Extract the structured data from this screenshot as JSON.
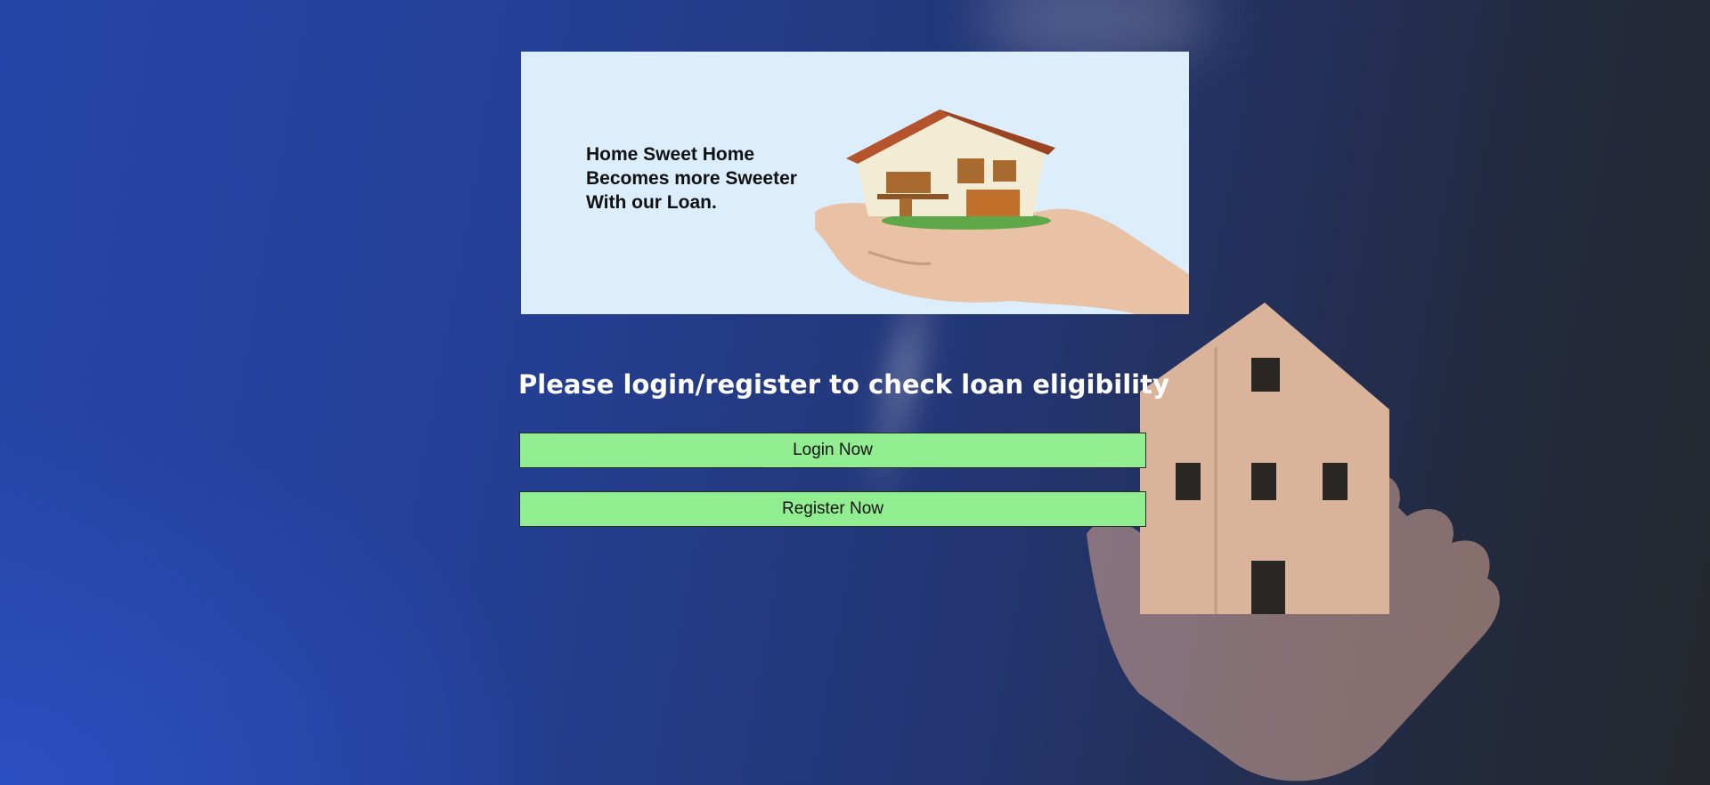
{
  "banner": {
    "lines": [
      "Home Sweet Home",
      "Becomes more Sweeter",
      "With our Loan."
    ],
    "image_icon": "house-in-hand"
  },
  "headline": "Please login/register to check loan eligibility",
  "buttons": {
    "login_label": "Login Now",
    "register_label": "Register Now"
  },
  "background": {
    "image_icon": "hand-holding-wooden-house",
    "colors": {
      "left": "#2546a8",
      "right": "#24272c"
    }
  },
  "colors": {
    "button_bg": "#90ee90",
    "banner_bg": "#dcedfb",
    "headline": "#ffffff"
  }
}
